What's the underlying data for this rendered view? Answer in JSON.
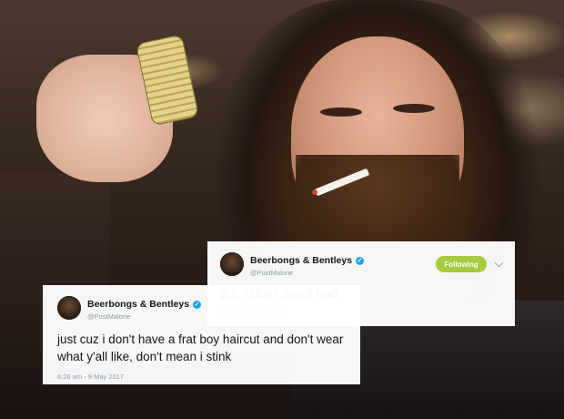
{
  "tweets": [
    {
      "display_name": "Beerbongs & Bentleys",
      "handle": "@PostMalone",
      "follow_label": "Following",
      "text": "p.s. i don't smell bad.",
      "timestamp": "4:32 PM - 14 Jan 2017"
    },
    {
      "display_name": "Beerbongs & Bentleys",
      "handle": "@PostMalone",
      "text": "just cuz i don't have a frat boy haircut and don't wear what y'all like, don't mean i stink",
      "timestamp": "6:26 am - 9 May 2017"
    }
  ],
  "colors": {
    "follow_button": "#a7cb3f",
    "verified_badge": "#1da1f2",
    "meta_text": "#8899a6"
  },
  "icons": [
    "verified-badge-icon",
    "chevron-down-icon"
  ]
}
